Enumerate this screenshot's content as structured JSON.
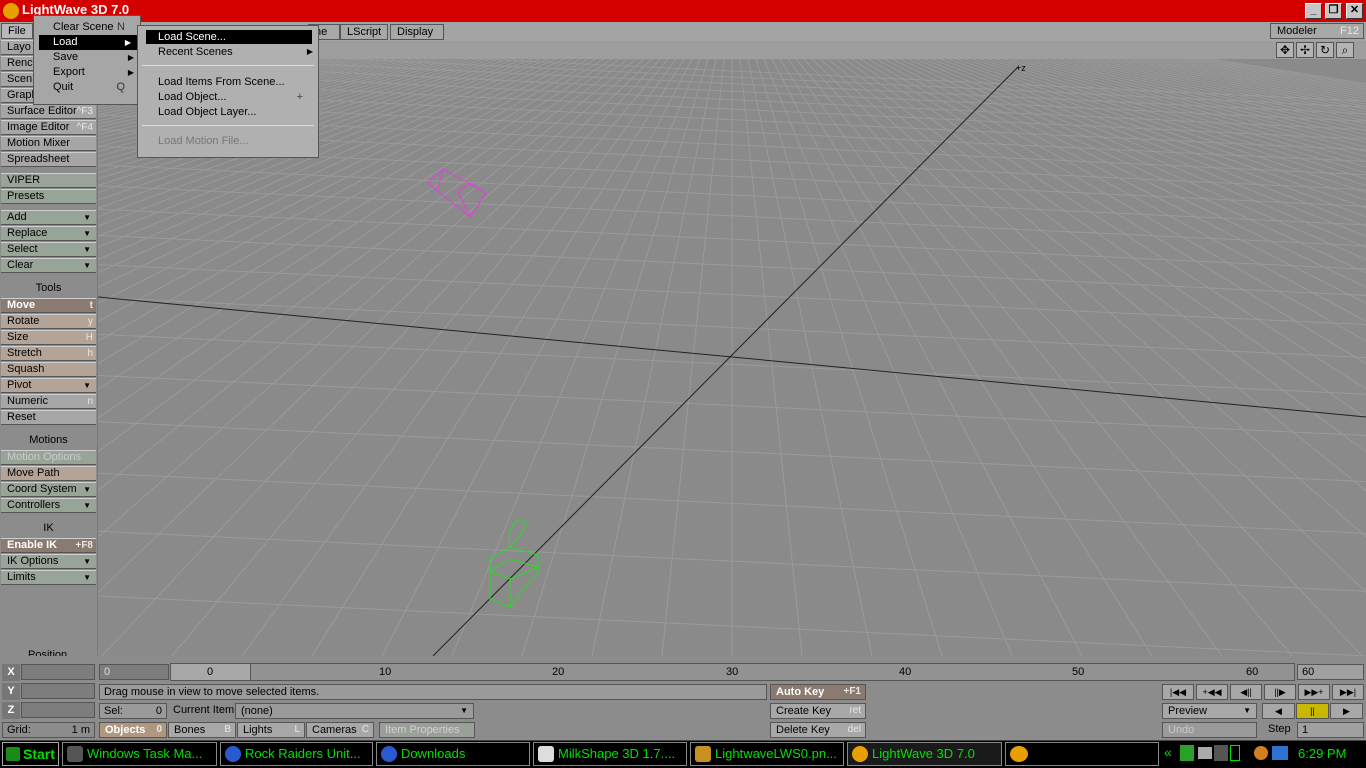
{
  "window": {
    "title": "LightWave 3D 7.0",
    "min": "_",
    "max": "❐",
    "close": "✕"
  },
  "menubar": {
    "file": "File",
    "tabs": [
      "ne",
      "LScript",
      "Display"
    ],
    "modeler": "Modeler",
    "modeler_key": "F12"
  },
  "file_menu": {
    "items": [
      {
        "label": "Clear Scene",
        "key": "N"
      },
      {
        "label": "Load",
        "key": ""
      },
      {
        "label": "Save",
        "key": ""
      },
      {
        "label": "Export",
        "key": ""
      },
      {
        "label": "Quit",
        "key": "Q"
      }
    ]
  },
  "load_menu": {
    "load_scene": "Load Scene...",
    "recent_scenes": "Recent Scenes",
    "load_items": "Load Items From Scene...",
    "load_object": "Load Object...",
    "load_object_key": "+",
    "load_object_layer": "Load Object Layer...",
    "load_motion": "Load Motion File..."
  },
  "left": {
    "partial": [
      "Layo",
      "Renc",
      "Scen",
      "Grapl"
    ],
    "surface_editor": "Surface Editor",
    "surface_key": "^F3",
    "image_editor": "Image Editor",
    "image_key": "^F4",
    "motion_mixer": "Motion Mixer",
    "spreadsheet": "Spreadsheet",
    "viper": "VIPER",
    "presets": "Presets",
    "add": "Add",
    "replace": "Replace",
    "select": "Select",
    "clear": "Clear",
    "tools": "Tools",
    "move": "Move",
    "move_key": "t",
    "rotate": "Rotate",
    "rotate_key": "y",
    "size": "Size",
    "size_key": "H",
    "stretch": "Stretch",
    "stretch_key": "h",
    "squash": "Squash",
    "pivot": "Pivot",
    "numeric": "Numeric",
    "numeric_key": "n",
    "reset": "Reset",
    "motions": "Motions",
    "motion_options": "Motion Options",
    "move_path": "Move Path",
    "coord_system": "Coord System",
    "controllers": "Controllers",
    "ik": "IK",
    "enable_ik": "Enable IK",
    "enable_ik_key": "+F8",
    "ik_options": "IK Options",
    "limits": "Limits",
    "position": "Position"
  },
  "bottom": {
    "x": "X",
    "y": "Y",
    "z": "Z",
    "grid_label": "Grid:",
    "grid_value": "1 m",
    "frame_start": "0",
    "frame_current": "0",
    "frame_end": "60",
    "ticks": [
      "10",
      "20",
      "30",
      "40",
      "50",
      "60"
    ],
    "status": "Drag mouse in view to move selected items.",
    "sel_label": "Sel:",
    "sel_value": "0",
    "current_item_label": "Current Item",
    "current_item": "(none)",
    "objects": "Objects",
    "objects_n": "0",
    "bones": "Bones",
    "bones_k": "B",
    "lights": "Lights",
    "lights_k": "L",
    "cameras": "Cameras",
    "cameras_k": "C",
    "item_properties": "Item Properties",
    "auto_key": "Auto Key",
    "auto_key_k": "+F1",
    "create_key": "Create Key",
    "create_key_k": "ret",
    "delete_key": "Delete Key",
    "delete_key_k": "del",
    "preview": "Preview",
    "undo": "Undo",
    "step_label": "Step",
    "step_value": "1"
  },
  "taskbar": {
    "start": "Start",
    "tasks": [
      "Windows Task Ma...",
      "Rock Raiders Unit...",
      "Downloads",
      "MilkShape 3D 1.7....",
      "LightwaveLWS0.pn...",
      "LightWave 3D 7.0"
    ],
    "tray_arrow": "«",
    "clock": "6:29 PM"
  },
  "colors": {
    "title": "#d40000",
    "task_text": "#00e000",
    "object_magenta": "#e040e0",
    "object_green": "#20e020"
  }
}
